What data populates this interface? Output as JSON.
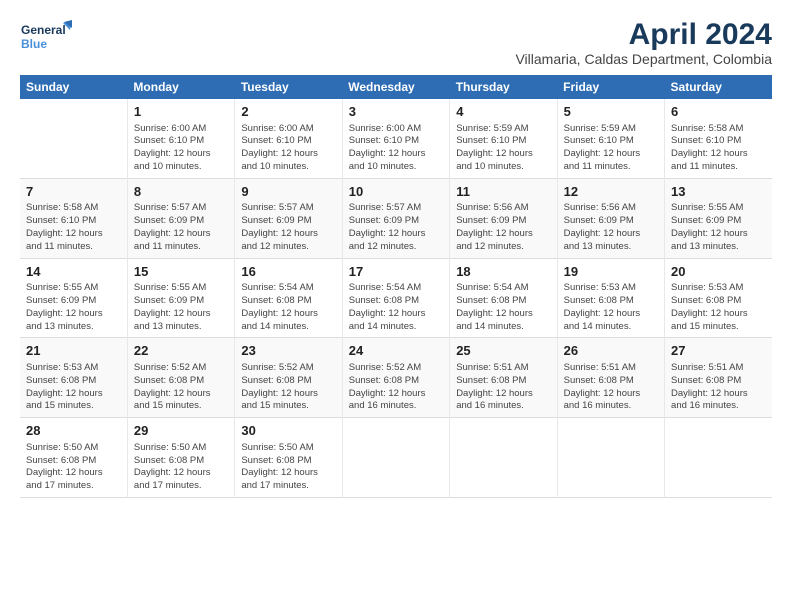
{
  "logo": {
    "line1": "General",
    "line2": "Blue"
  },
  "title": "April 2024",
  "subtitle": "Villamaria, Caldas Department, Colombia",
  "columns": [
    "Sunday",
    "Monday",
    "Tuesday",
    "Wednesday",
    "Thursday",
    "Friday",
    "Saturday"
  ],
  "weeks": [
    {
      "days": [
        {
          "num": "",
          "info": ""
        },
        {
          "num": "1",
          "info": "Sunrise: 6:00 AM\nSunset: 6:10 PM\nDaylight: 12 hours\nand 10 minutes."
        },
        {
          "num": "2",
          "info": "Sunrise: 6:00 AM\nSunset: 6:10 PM\nDaylight: 12 hours\nand 10 minutes."
        },
        {
          "num": "3",
          "info": "Sunrise: 6:00 AM\nSunset: 6:10 PM\nDaylight: 12 hours\nand 10 minutes."
        },
        {
          "num": "4",
          "info": "Sunrise: 5:59 AM\nSunset: 6:10 PM\nDaylight: 12 hours\nand 10 minutes."
        },
        {
          "num": "5",
          "info": "Sunrise: 5:59 AM\nSunset: 6:10 PM\nDaylight: 12 hours\nand 11 minutes."
        },
        {
          "num": "6",
          "info": "Sunrise: 5:58 AM\nSunset: 6:10 PM\nDaylight: 12 hours\nand 11 minutes."
        }
      ]
    },
    {
      "days": [
        {
          "num": "7",
          "info": "Sunrise: 5:58 AM\nSunset: 6:10 PM\nDaylight: 12 hours\nand 11 minutes."
        },
        {
          "num": "8",
          "info": "Sunrise: 5:57 AM\nSunset: 6:09 PM\nDaylight: 12 hours\nand 11 minutes."
        },
        {
          "num": "9",
          "info": "Sunrise: 5:57 AM\nSunset: 6:09 PM\nDaylight: 12 hours\nand 12 minutes."
        },
        {
          "num": "10",
          "info": "Sunrise: 5:57 AM\nSunset: 6:09 PM\nDaylight: 12 hours\nand 12 minutes."
        },
        {
          "num": "11",
          "info": "Sunrise: 5:56 AM\nSunset: 6:09 PM\nDaylight: 12 hours\nand 12 minutes."
        },
        {
          "num": "12",
          "info": "Sunrise: 5:56 AM\nSunset: 6:09 PM\nDaylight: 12 hours\nand 13 minutes."
        },
        {
          "num": "13",
          "info": "Sunrise: 5:55 AM\nSunset: 6:09 PM\nDaylight: 12 hours\nand 13 minutes."
        }
      ]
    },
    {
      "days": [
        {
          "num": "14",
          "info": "Sunrise: 5:55 AM\nSunset: 6:09 PM\nDaylight: 12 hours\nand 13 minutes."
        },
        {
          "num": "15",
          "info": "Sunrise: 5:55 AM\nSunset: 6:09 PM\nDaylight: 12 hours\nand 13 minutes."
        },
        {
          "num": "16",
          "info": "Sunrise: 5:54 AM\nSunset: 6:08 PM\nDaylight: 12 hours\nand 14 minutes."
        },
        {
          "num": "17",
          "info": "Sunrise: 5:54 AM\nSunset: 6:08 PM\nDaylight: 12 hours\nand 14 minutes."
        },
        {
          "num": "18",
          "info": "Sunrise: 5:54 AM\nSunset: 6:08 PM\nDaylight: 12 hours\nand 14 minutes."
        },
        {
          "num": "19",
          "info": "Sunrise: 5:53 AM\nSunset: 6:08 PM\nDaylight: 12 hours\nand 14 minutes."
        },
        {
          "num": "20",
          "info": "Sunrise: 5:53 AM\nSunset: 6:08 PM\nDaylight: 12 hours\nand 15 minutes."
        }
      ]
    },
    {
      "days": [
        {
          "num": "21",
          "info": "Sunrise: 5:53 AM\nSunset: 6:08 PM\nDaylight: 12 hours\nand 15 minutes."
        },
        {
          "num": "22",
          "info": "Sunrise: 5:52 AM\nSunset: 6:08 PM\nDaylight: 12 hours\nand 15 minutes."
        },
        {
          "num": "23",
          "info": "Sunrise: 5:52 AM\nSunset: 6:08 PM\nDaylight: 12 hours\nand 15 minutes."
        },
        {
          "num": "24",
          "info": "Sunrise: 5:52 AM\nSunset: 6:08 PM\nDaylight: 12 hours\nand 16 minutes."
        },
        {
          "num": "25",
          "info": "Sunrise: 5:51 AM\nSunset: 6:08 PM\nDaylight: 12 hours\nand 16 minutes."
        },
        {
          "num": "26",
          "info": "Sunrise: 5:51 AM\nSunset: 6:08 PM\nDaylight: 12 hours\nand 16 minutes."
        },
        {
          "num": "27",
          "info": "Sunrise: 5:51 AM\nSunset: 6:08 PM\nDaylight: 12 hours\nand 16 minutes."
        }
      ]
    },
    {
      "days": [
        {
          "num": "28",
          "info": "Sunrise: 5:50 AM\nSunset: 6:08 PM\nDaylight: 12 hours\nand 17 minutes."
        },
        {
          "num": "29",
          "info": "Sunrise: 5:50 AM\nSunset: 6:08 PM\nDaylight: 12 hours\nand 17 minutes."
        },
        {
          "num": "30",
          "info": "Sunrise: 5:50 AM\nSunset: 6:08 PM\nDaylight: 12 hours\nand 17 minutes."
        },
        {
          "num": "",
          "info": ""
        },
        {
          "num": "",
          "info": ""
        },
        {
          "num": "",
          "info": ""
        },
        {
          "num": "",
          "info": ""
        }
      ]
    }
  ]
}
